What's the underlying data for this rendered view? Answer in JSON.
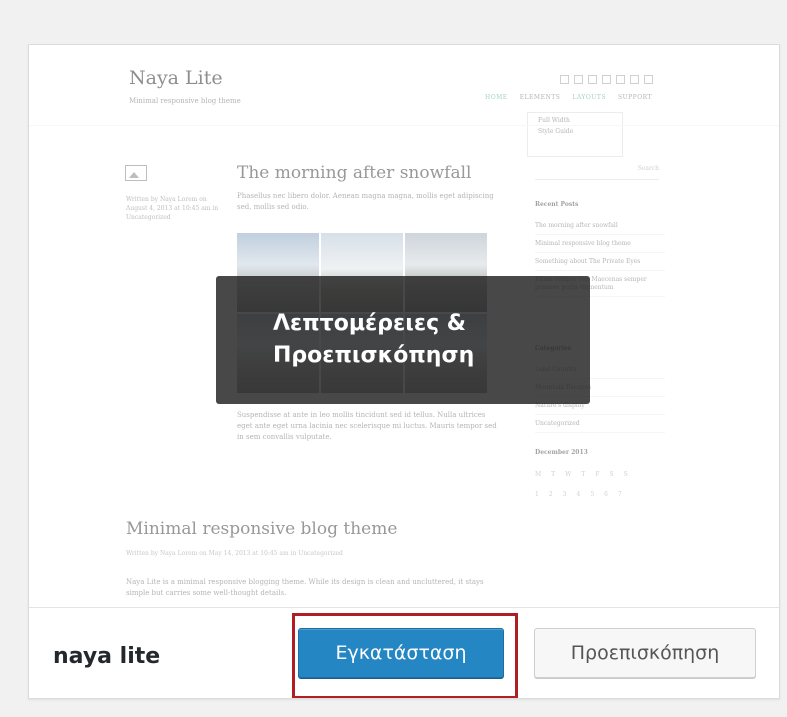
{
  "theme_card": {
    "theme_name": "naya lite",
    "overlay_label": "Λεπτομέρειες & Προεπισκόπηση",
    "install_label": "Εγκατάσταση",
    "preview_label": "Προεπισκόπηση",
    "colors": {
      "install_button": "#2586c4",
      "highlight_border": "#b01e23",
      "overlay_background": "#202020"
    }
  },
  "screenshot": {
    "site_title": "Naya Lite",
    "site_tagline": "Minimal responsive blog theme",
    "nav_items": [
      "HOME",
      "ELEMENTS",
      "LAYOUTS",
      "SUPPORT"
    ],
    "dropdown_items": [
      "Full Width",
      "Style Guide"
    ],
    "post_title": "The morning after snowfall",
    "post_excerpt": "Phasellus nec libero dolor. Aenean magna magna, mollis eget adipiscing sed, mollis sed odio.",
    "post_meta": "Written by Naya Lorem on August 4, 2013 at 10:45 am in Uncategorized",
    "post_body": "Suspendisse at ante in leo mollis tincidunt sed id tellus. Nulla ultrices eget ante eget urna lacinia nec scelerisque mi luctus. Mauris tempor sed in sem convallis vulputate.",
    "post2_title": "Minimal responsive blog theme",
    "post2_meta": "Written by Naya Lorem on May 14, 2013 at 10:45 am in Uncategorized",
    "post2_body": "Naya Lite is a minimal responsive blogging theme. While its design is clean and uncluttered, it stays simple but carries some well-thought details.",
    "search_placeholder": "Search",
    "sidebar_recent_heading": "Recent Posts",
    "sidebar_recent": [
      "The morning after snowfall",
      "Minimal responsive blog theme",
      "Something about The Private Eyes",
      "Etiam tempor leo. Maecenas semper posuere porta elementum"
    ],
    "sidebar_categories_heading": "Categories",
    "sidebar_categories": [
      "Land Country",
      "Mountain Escapes",
      "Nature's display",
      "Uncategorized"
    ],
    "sidebar_calendar_heading": "December 2013",
    "calendar_rows": [
      [
        "M",
        "T",
        "W",
        "T",
        "F",
        "S",
        "S"
      ],
      [
        "1",
        "2",
        "3",
        "4",
        "5",
        "6",
        "7"
      ]
    ]
  }
}
